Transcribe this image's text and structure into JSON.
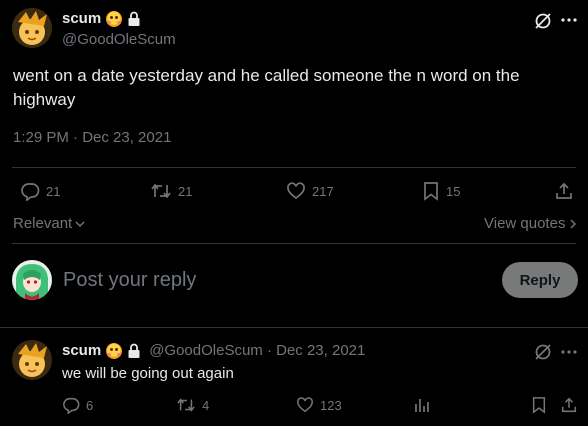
{
  "tweet": {
    "display_name": "scum",
    "handle": "@GoodOleScum",
    "text": "went on a date yesterday and he called someone the n word on the highway",
    "timestamp": "1:29 PM · Dec 23, 2021",
    "metrics": {
      "replies": "21",
      "retweets": "21",
      "likes": "217",
      "bookmarks": "15"
    }
  },
  "sort": {
    "label": "Relevant",
    "view_quotes": "View quotes"
  },
  "composer": {
    "placeholder": "Post your reply",
    "reply_button": "Reply"
  },
  "reply": {
    "display_name": "scum",
    "handle_date": "@GoodOleScum · Dec 23, 2021",
    "text": "we will be going out again",
    "metrics": {
      "replies": "6",
      "retweets": "4",
      "likes": "123"
    }
  },
  "colors": {
    "background": "#000000",
    "text": "#e7e9ea",
    "muted": "#71767b",
    "divider": "#2f3336",
    "reply_button_bg": "#787a7a"
  }
}
